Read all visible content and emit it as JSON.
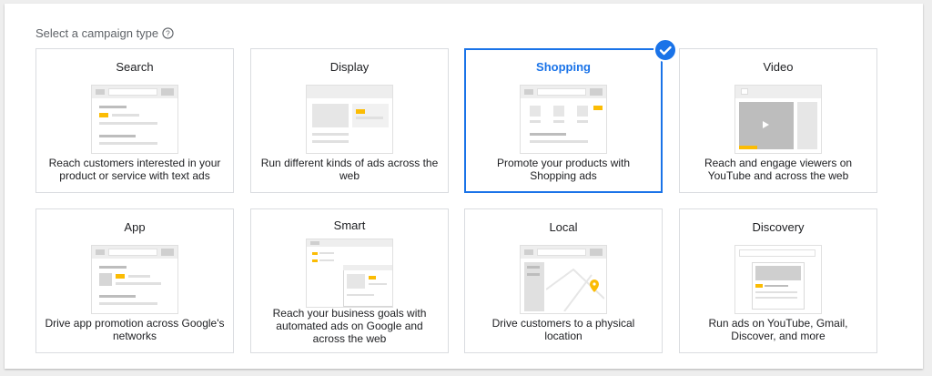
{
  "page": {
    "heading": "Select a campaign type",
    "accent_color": "#1a73e8",
    "highlight_color": "#fbbc04"
  },
  "campaign_types": [
    {
      "title": "Search",
      "description": "Reach customers interested in your product or service with text ads",
      "selected": false
    },
    {
      "title": "Display",
      "description": "Run different kinds of ads across the web",
      "selected": false
    },
    {
      "title": "Shopping",
      "description": "Promote your products with Shopping ads",
      "selected": true
    },
    {
      "title": "Video",
      "description": "Reach and engage viewers on YouTube and across the web",
      "selected": false
    },
    {
      "title": "App",
      "description": "Drive app promotion across Google's networks",
      "selected": false
    },
    {
      "title": "Smart",
      "description": "Reach your business goals with automated ads on Google and across the web",
      "selected": false
    },
    {
      "title": "Local",
      "description": "Drive customers to a physical location",
      "selected": false
    },
    {
      "title": "Discovery",
      "description": "Run ads on YouTube, Gmail, Discover, and more",
      "selected": false
    }
  ],
  "icons": {
    "help": "help-circle-icon",
    "selected": "checkmark-icon"
  }
}
